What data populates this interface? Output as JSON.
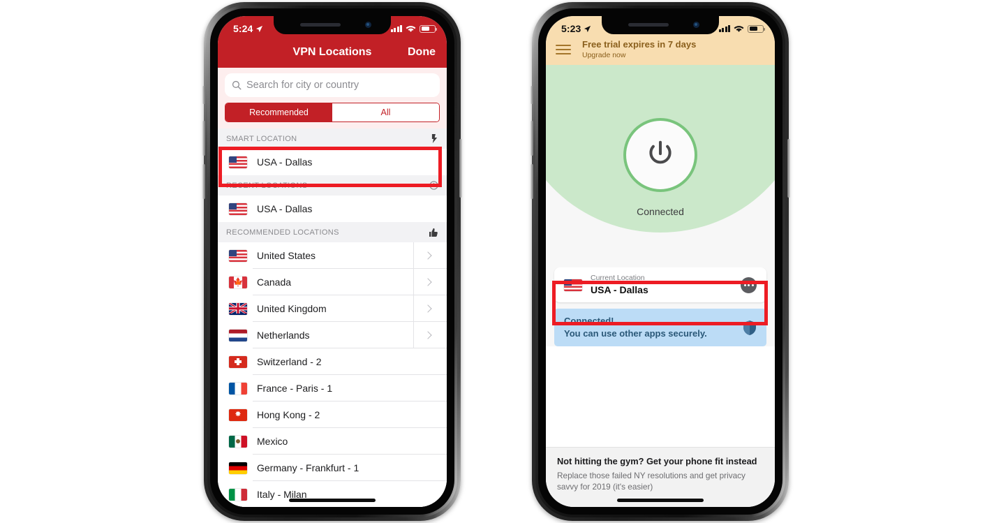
{
  "left_phone": {
    "status_bar": {
      "time": "5:24",
      "location_arrow_icon": "location-arrow-icon",
      "signal_icon": "cellular-signal-icon",
      "wifi_icon": "wifi-icon",
      "battery_icon": "battery-icon"
    },
    "navbar": {
      "title": "VPN Locations",
      "done_label": "Done"
    },
    "search": {
      "placeholder": "Search for city or country",
      "icon": "search-icon"
    },
    "segmented": {
      "options": [
        "Recommended",
        "All"
      ],
      "selected": "Recommended"
    },
    "sections": [
      {
        "header": "SMART LOCATION",
        "icon": "lightning-bolt-icon",
        "rows": [
          {
            "flag": "us",
            "name": "USA - Dallas",
            "chevron": false
          }
        ]
      },
      {
        "header": "RECENT LOCATIONS",
        "icon": "clock-icon",
        "rows": [
          {
            "flag": "us",
            "name": "USA - Dallas",
            "chevron": false
          }
        ]
      },
      {
        "header": "RECOMMENDED LOCATIONS",
        "icon": "thumbs-up-icon",
        "rows": [
          {
            "flag": "us",
            "name": "United States",
            "chevron": true
          },
          {
            "flag": "ca",
            "name": "Canada",
            "chevron": true
          },
          {
            "flag": "uk",
            "name": "United Kingdom",
            "chevron": true
          },
          {
            "flag": "nl",
            "name": "Netherlands",
            "chevron": true
          },
          {
            "flag": "ch",
            "name": "Switzerland - 2",
            "chevron": false
          },
          {
            "flag": "fr",
            "name": "France - Paris - 1",
            "chevron": false
          },
          {
            "flag": "hk",
            "name": "Hong Kong - 2",
            "chevron": false
          },
          {
            "flag": "mx",
            "name": "Mexico",
            "chevron": false
          },
          {
            "flag": "de",
            "name": "Germany - Frankfurt - 1",
            "chevron": false
          },
          {
            "flag": "it",
            "name": "Italy - Milan",
            "chevron": false
          }
        ]
      }
    ]
  },
  "right_phone": {
    "status_bar": {
      "time": "5:23",
      "location_arrow_icon": "location-arrow-icon",
      "signal_icon": "cellular-signal-icon",
      "wifi_icon": "wifi-icon",
      "battery_icon": "battery-icon"
    },
    "trial_banner": {
      "menu_icon": "hamburger-menu-icon",
      "title": "Free trial expires in 7 days",
      "subtitle": "Upgrade now"
    },
    "hero": {
      "power_icon": "power-button-icon",
      "status_label": "Connected"
    },
    "location_card": {
      "flag": "us",
      "caption": "Current Location",
      "value": "USA - Dallas",
      "more_icon": "ellipsis-icon"
    },
    "connected_banner": {
      "line1": "Connected!",
      "line2": "You can use other apps securely.",
      "icon": "shield-icon"
    },
    "article": {
      "title": "Not hitting the gym? Get your phone fit instead",
      "body": "Replace those failed NY resolutions and get privacy savvy for 2019 (it's easier)"
    }
  },
  "annotations": {
    "color": "#ed1c24",
    "count": 2
  },
  "colors": {
    "brand_red": "#c22026",
    "annotation_red": "#ed1c24",
    "trial_bg": "#f8ddb0",
    "trial_text": "#8a5f1c",
    "hero_green": "#cbe8ca",
    "power_ring": "#79c47c",
    "banner_blue": "#bcdcf6",
    "banner_text": "#2a5878"
  }
}
